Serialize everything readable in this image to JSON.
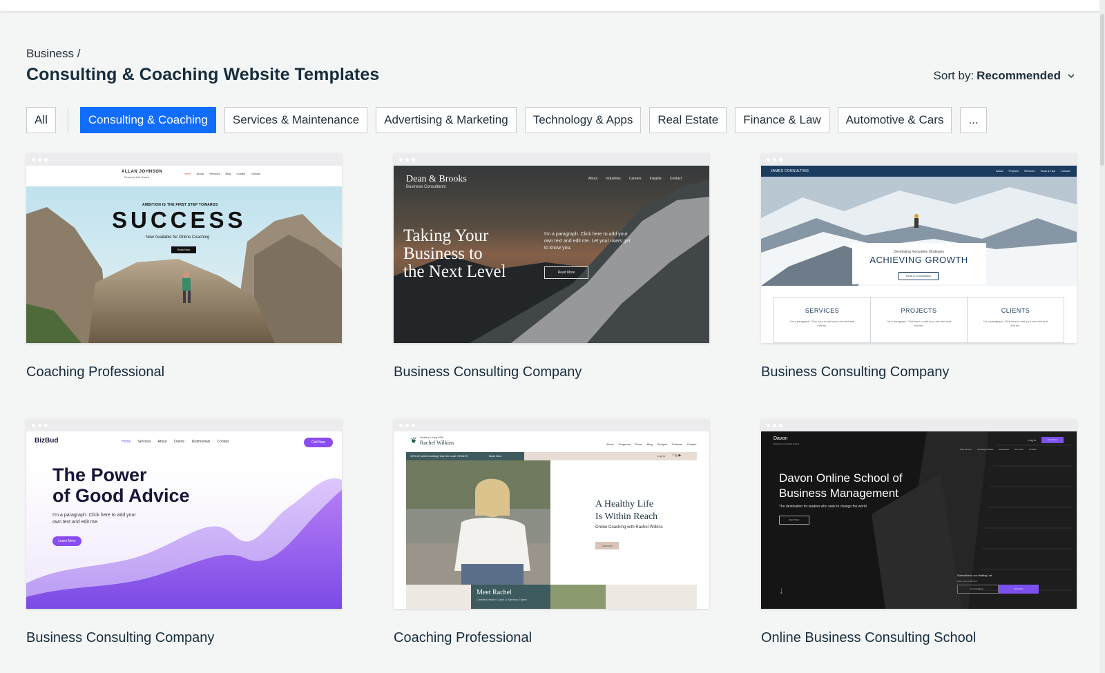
{
  "breadcrumb": "Business /",
  "title": "Consulting & Coaching Website Templates",
  "sort": {
    "label": "Sort by:",
    "value": "Recommended"
  },
  "filters": {
    "all": "All",
    "items": [
      "Consulting & Coaching",
      "Services & Maintenance",
      "Advertising & Marketing",
      "Technology & Apps",
      "Real Estate",
      "Finance & Law",
      "Automotive & Cars",
      "..."
    ]
  },
  "colors": {
    "accent": "#116dff",
    "page_bg": "#f4f5f5",
    "text": "#162d3d"
  },
  "cards": [
    {
      "title": "Coaching Professional",
      "preview": {
        "brand": "ALLAN JOHNSON",
        "brand_sub": "Personal Life Coach",
        "nav": [
          "Home",
          "About",
          "Services",
          "Blog",
          "Guides",
          "Contact"
        ],
        "kicker": "AMBITION IS THE FIRST STEP TOWARDS",
        "headline": "SUCCESS",
        "sub": "Now Available for Online Coaching",
        "cta": "Book Now"
      }
    },
    {
      "title": "Business Consulting Company",
      "preview": {
        "brand": "Dean & Brooks",
        "brand_sub": "Business Consultants",
        "nav": [
          "About",
          "Industries",
          "Careers",
          "Insights",
          "Contact"
        ],
        "headline_lines": [
          "Taking Your",
          "Business to",
          "the Next Level"
        ],
        "para_lines": [
          "I'm a paragraph. Click here to add your",
          "own text and edit me. Let your users get",
          "to know you."
        ],
        "cta": "Read More"
      }
    },
    {
      "title": "Business Consulting Company",
      "preview": {
        "brand": "JAMES CONSULTING",
        "nav": [
          "About",
          "Projects",
          "Services",
          "Tools & Tips",
          "Contact"
        ],
        "kicker": "Developing Innovative Strategies",
        "headline": "ACHIEVING GROWTH",
        "cta": "Book A Consultation",
        "columns": [
          "SERVICES",
          "PROJECTS",
          "CLIENTS"
        ],
        "column_text": "I'm a paragraph. Click here to add your own text and edit me."
      }
    },
    {
      "title": "Business Consulting Company",
      "preview": {
        "brand": "BizBud",
        "nav": [
          "Home",
          "Services",
          "About",
          "Clients",
          "Testimonials",
          "Contact"
        ],
        "nav_cta": "Call Now",
        "headline_lines": [
          "The Power",
          "of Good Advice"
        ],
        "para_lines": [
          "I'm a paragraph. Click here to add your",
          "own text and edit me."
        ],
        "cta": "Learn More"
      }
    },
    {
      "title": "Coaching Professional",
      "preview": {
        "brand_kicker": "Healthy Living With",
        "brand": "Rachel Wilkins",
        "nav": [
          "About",
          "Programs",
          "Plans",
          "Blog",
          "Recipes",
          "Podcast",
          "Contact"
        ],
        "promo": "10% off online booking! Use the code: HEALTH",
        "promo_cta": "Book Now",
        "login": "Log In",
        "headline_lines": [
          "A Healthy Life",
          "Is Within Reach"
        ],
        "sub": "Online Coaching with Rachel Wilkins",
        "cta": "Discover",
        "name_card": "Meet Rachel",
        "name_sub": "Certified Health Coach & Nutrition Expert"
      }
    },
    {
      "title": "Online Business Consulting School",
      "preview": {
        "brand": "Davon",
        "brand_sub": "Business Consulting School",
        "nav": [
          "Who We Are",
          "Learning Modules",
          "Resources",
          "Our Team",
          "Contact"
        ],
        "login": "Log In",
        "nav_cta": "Enroll Now",
        "headline_lines": [
          "Davon Online School of",
          "Business Management"
        ],
        "sub": "The destination for leaders who seek to change the world",
        "cta": "Enroll Now",
        "subscribe_title": "Subscribe to our Mailing List",
        "subscribe_label": "Enter your email here*",
        "subscribe_placeholder": "Email Address",
        "subscribe_cta": "Subscribe"
      }
    }
  ]
}
